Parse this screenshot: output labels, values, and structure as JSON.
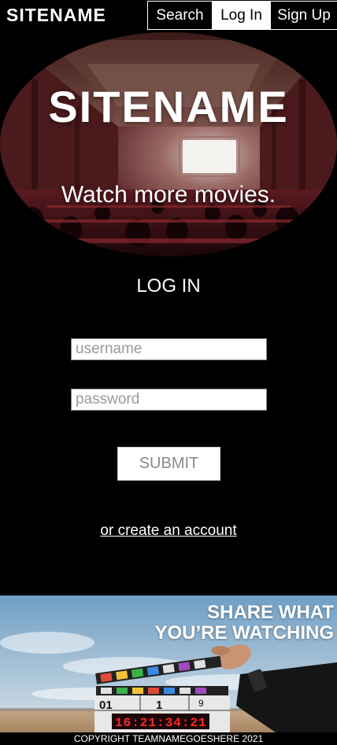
{
  "header": {
    "logo": "SITENAME",
    "nav": {
      "search": "Search",
      "login": "Log In",
      "signup": "Sign Up"
    }
  },
  "hero": {
    "title": "SITENAME",
    "tagline": "Watch more movies."
  },
  "login": {
    "title": "LOG IN",
    "username_placeholder": "username",
    "password_placeholder": "password",
    "submit": "SUBMIT",
    "create_account": "or create an account"
  },
  "promo": {
    "line1": "SHARE WHAT",
    "line2": "YOU’RE WATCHING",
    "slate": {
      "scene": "01",
      "take": "1",
      "roll": "9",
      "timecode": "16:21:34:21"
    }
  },
  "footer": {
    "copyright": "COPYRIGHT TEAMNAMEGOESHERE 2021"
  },
  "colors": {
    "background": "#000000",
    "text": "#ffffff",
    "accent_red": "#ff2a2a"
  }
}
